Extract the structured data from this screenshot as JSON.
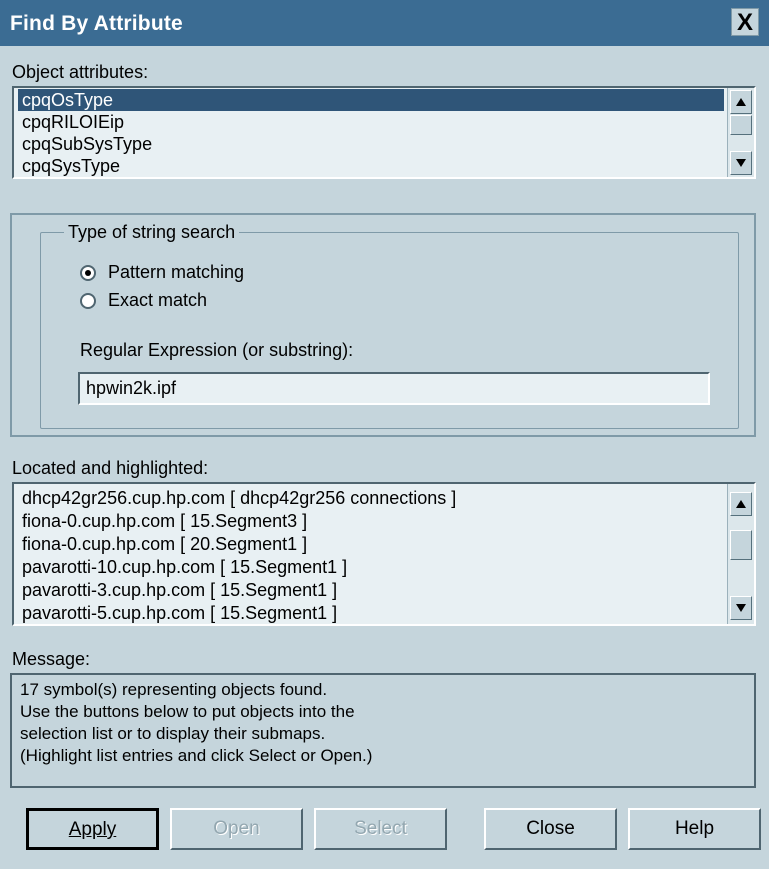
{
  "window": {
    "title": "Find By Attribute",
    "close_glyph": "X"
  },
  "object_attributes": {
    "label": "Object attributes:",
    "items": [
      "cpqOsType",
      "cpqRILOIEip",
      "cpqSubSysType",
      "cpqSysType"
    ],
    "selected_index": 0
  },
  "string_search": {
    "group_label": "Type of string search",
    "options": [
      {
        "label": "Pattern matching",
        "checked": true
      },
      {
        "label": "Exact match",
        "checked": false
      }
    ],
    "regex_label": "Regular Expression (or substring):",
    "regex_value": "hpwin2k.ipf"
  },
  "located": {
    "label": "Located and highlighted:",
    "items": [
      "dhcp42gr256.cup.hp.com  [ dhcp42gr256 connections ]",
      "fiona-0.cup.hp.com  [ 15.Segment3 ]",
      "fiona-0.cup.hp.com  [ 20.Segment1 ]",
      "pavarotti-10.cup.hp.com  [ 15.Segment1 ]",
      "pavarotti-3.cup.hp.com  [ 15.Segment1 ]",
      "pavarotti-5.cup.hp.com  [ 15.Segment1 ]"
    ]
  },
  "message": {
    "label": "Message:",
    "lines": [
      "17 symbol(s) representing objects found.",
      "Use the buttons below to put objects into the",
      "selection list or to display their submaps.",
      "(Highlight list entries and click Select or Open.)"
    ]
  },
  "buttons": {
    "apply": "Apply",
    "open": "Open",
    "select": "Select",
    "close": "Close",
    "help": "Help"
  },
  "icons": {
    "scroll_up": "up-arrow-icon",
    "scroll_down": "down-arrow-icon"
  },
  "colors": {
    "titlebar": "#3b6c93",
    "dialog_bg": "#c5d5dc",
    "selection": "#2f5578"
  }
}
